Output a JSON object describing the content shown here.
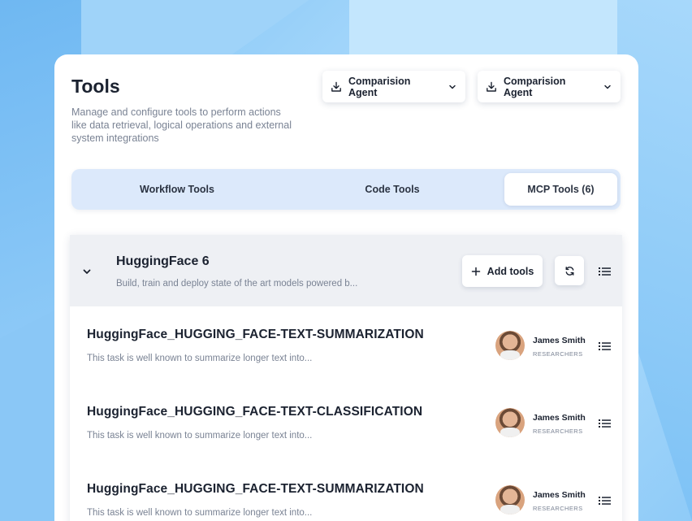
{
  "page": {
    "title": "Tools",
    "subtitle": "Manage and configure tools to perform actions like data retrieval, logical operations and external system integrations"
  },
  "agent_selectors": [
    {
      "label": "Comparision Agent"
    },
    {
      "label": "Comparision Agent"
    }
  ],
  "tabs": [
    {
      "label": "Workflow Tools",
      "active": false
    },
    {
      "label": "Code Tools",
      "active": false
    },
    {
      "label": "MCP Tools (6)",
      "active": true
    }
  ],
  "group": {
    "title": "HuggingFace 6",
    "description": "Build, train and deploy state of the art models powered b...",
    "add_label": "Add tools",
    "expanded": true
  },
  "tools": [
    {
      "name": "HuggingFace_HUGGING_FACE-TEXT-SUMMARIZATION",
      "description": "This task is well known to summarize longer text into...",
      "owner": "James Smith",
      "role": "RESEARCHERS"
    },
    {
      "name": "HuggingFace_HUGGING_FACE-TEXT-CLASSIFICATION",
      "description": "This task is well known to summarize longer text into...",
      "owner": "James Smith",
      "role": "RESEARCHERS"
    },
    {
      "name": "HuggingFace_HUGGING_FACE-TEXT-SUMMARIZATION",
      "description": "This task is well known to summarize longer text into...",
      "owner": "James Smith",
      "role": "RESEARCHERS"
    }
  ],
  "icons": {
    "download": "download-icon",
    "chevron": "chevron-down-icon",
    "plus": "plus-icon",
    "refresh": "refresh-icon",
    "menu": "list-menu-icon"
  },
  "colors": {
    "tabs_bg": "#dce9fb",
    "group_head_bg": "#eef0f4",
    "text_primary": "#1b2230",
    "text_muted": "#7a8394"
  }
}
